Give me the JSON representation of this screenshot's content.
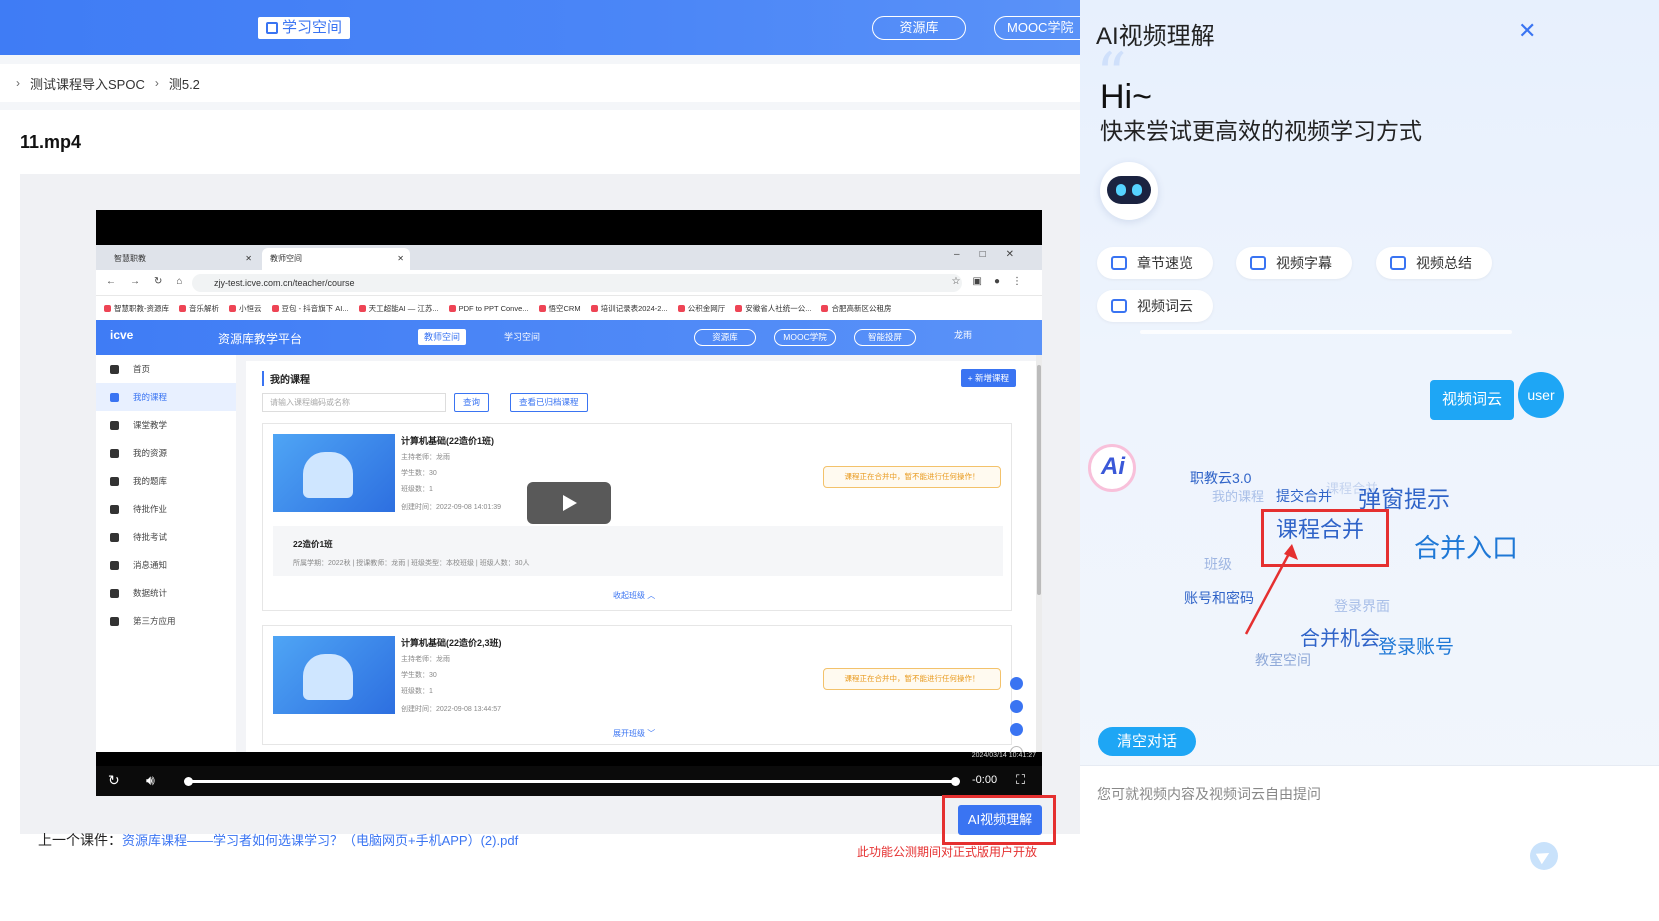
{
  "topbar": {
    "space_label": "学习空间",
    "nav": [
      "资源库",
      "MOOC学院"
    ]
  },
  "breadcrumb": [
    "测试课程导入SPOC",
    "测5.2"
  ],
  "file_title": "11.mp4",
  "video": {
    "browser_tabs": [
      "智慧职教",
      "教师空间"
    ],
    "url": "zjy-test.icve.com.cn/teacher/course",
    "bookmarks": [
      "智慧职教-资源库",
      "音乐解析",
      "小恒云",
      "豆包 - 抖音旗下 AI...",
      "天工超能AI — 江苏...",
      "PDF to PPT Conve...",
      "悟空CRM",
      "培训记录表2024-2...",
      "公积金网厅",
      "安徽省人社统一公...",
      "合肥高新区公租房"
    ],
    "app": {
      "logo": "icve",
      "platform": "资源库教学平台",
      "seg_active": "教师空间",
      "seg_plain": "学习空间",
      "pills": [
        "资源库",
        "MOOC学院",
        "智能投屏"
      ],
      "user": "龙雨"
    },
    "sidebar": [
      "首页",
      "我的课程",
      "课堂教学",
      "我的资源",
      "我的题库",
      "待批作业",
      "待批考试",
      "消息通知",
      "数据统计",
      "第三方应用"
    ],
    "content": {
      "heading": "我的课程",
      "new_button": "+ 新增课程",
      "search_placeholder": "请输入课程编码或名称",
      "query_button": "查询",
      "archived_button": "查看已归档课程",
      "cards": [
        {
          "title": "计算机基础(22造价1班)",
          "teacher": "主持老师：龙雨",
          "students": "学生数：30",
          "classes": "班级数：1",
          "created": "创建时间：2022-09-08 14:01:39",
          "notice": "课程正在合并中，暂不能进行任何操作！",
          "class_name": "22造价1班",
          "class_detail": "所属学期：2022秋  |  授课教师：龙雨  |  班级类型：本校班级  |  班级人数：30人",
          "toggle": "收起班级 ︿"
        },
        {
          "title": "计算机基础(22造价2,3班)",
          "teacher": "主持老师：龙雨",
          "students": "学生数：30",
          "classes": "班级数：1",
          "created": "创建时间：2022-09-08 13:44:57",
          "notice": "课程正在合并中，暂不能进行任何操作！",
          "toggle": "展开班级 ﹀"
        }
      ]
    },
    "timestamp": "2024/03/14 10:41:27",
    "time_remaining": "-0:00"
  },
  "ai_button": "AI视频理解",
  "prev_label": "上一个课件：",
  "prev_link": "资源库课程——学习者如何选课学习？（电脑网页+手机APP）(2).pdf",
  "beta_note": "此功能公测期间对正式版用户开放",
  "ai_panel": {
    "title": "AI视频理解",
    "greeting": "Hi~",
    "subtitle": "快来尝试更高效的视频学习方式",
    "chips": [
      "章节速览",
      "视频字幕",
      "视频总结",
      "视频词云"
    ],
    "user_message": "视频词云",
    "user_avatar": "user",
    "ai_avatar": "Ai",
    "word_cloud": [
      {
        "text": "职教云3.0",
        "size": 14,
        "color": "#2f63c8"
      },
      {
        "text": "我的课程",
        "size": 13,
        "color": "#a9bfe8"
      },
      {
        "text": "提交合并",
        "size": 14,
        "color": "#2f63c8"
      },
      {
        "text": "课程合并",
        "size": 13,
        "color": "#c4d3ef"
      },
      {
        "text": "弹窗提示",
        "size": 23,
        "color": "#2f63c8"
      },
      {
        "text": "课程合并",
        "size": 22,
        "color": "#2f63c8"
      },
      {
        "text": "合并入口",
        "size": 26,
        "color": "#1e78d6"
      },
      {
        "text": "班级",
        "size": 14,
        "color": "#9fb6e2"
      },
      {
        "text": "账号和密码",
        "size": 14,
        "color": "#2f63c8"
      },
      {
        "text": "登录界面",
        "size": 14,
        "color": "#a9bfe8"
      },
      {
        "text": "合并机会",
        "size": 20,
        "color": "#2f63c8"
      },
      {
        "text": "登录账号",
        "size": 19,
        "color": "#1e78d6"
      },
      {
        "text": "教室空间",
        "size": 14,
        "color": "#8fa9d8"
      }
    ],
    "clear_button": "清空对话",
    "input_placeholder": "您可就视频内容及视频词云自由提问"
  },
  "colors": {
    "accent": "#3a74f2",
    "highlight": "#e53030",
    "chat_blue": "#1ea6f5"
  }
}
